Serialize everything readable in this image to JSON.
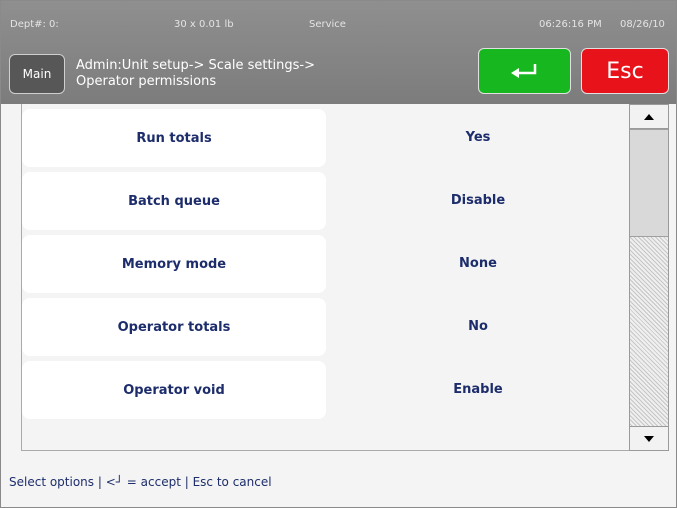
{
  "status_bar": {
    "dept": "Dept#: 0:",
    "capacity": "30 x 0.01 lb",
    "mode": "Service",
    "time": "06:26:16 PM",
    "date": "08/26/10"
  },
  "header": {
    "main_label": "Main",
    "breadcrumb_line1": "Admin:Unit setup-> Scale settings->",
    "breadcrumb_line2": "Operator permissions",
    "esc_label": "Esc"
  },
  "settings": [
    {
      "label": "Run totals",
      "value": "Yes"
    },
    {
      "label": "Batch queue",
      "value": "Disable"
    },
    {
      "label": "Memory mode",
      "value": "None"
    },
    {
      "label": "Operator totals",
      "value": "No"
    },
    {
      "label": "Operator void",
      "value": "Enable"
    }
  ],
  "footer": {
    "hint": "Select options | <┘ = accept | Esc to cancel"
  },
  "colors": {
    "header_bg": "#808080",
    "enter_button": "#17b81f",
    "esc_button": "#e8121b",
    "text_navy": "#1d2d6b"
  }
}
